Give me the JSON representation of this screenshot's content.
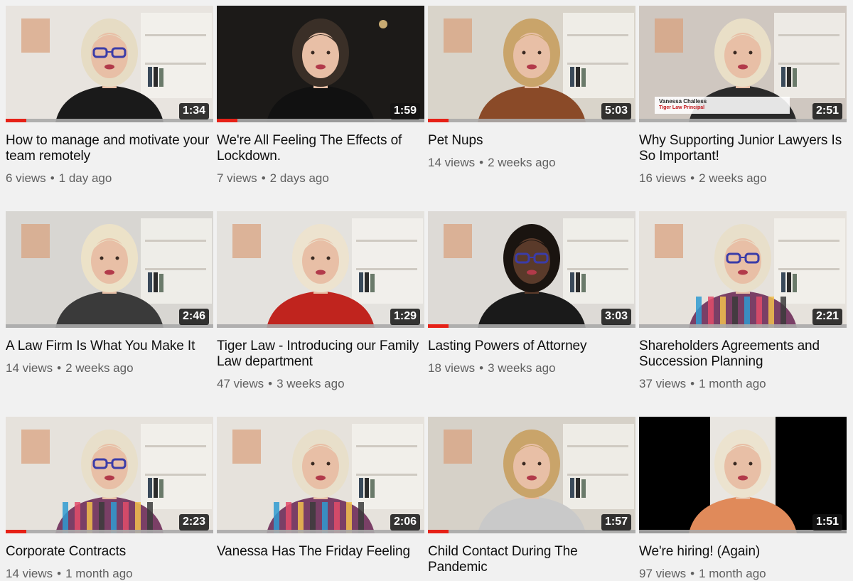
{
  "videos": [
    {
      "title": "How to manage and motivate your team remotely",
      "views": "6 views",
      "age": "1 day ago",
      "duration": "1:34",
      "watched_fraction": 0.1,
      "bg": "#e8e4df",
      "hair": "#e6dcc4",
      "top": "#1a1a1a",
      "glasses": true
    },
    {
      "title": "We're All Feeling The Effects of Lockdown.",
      "views": "7 views",
      "age": "2 days ago",
      "duration": "1:59",
      "watched_fraction": 0.1,
      "bg": "#1c1a18",
      "hair": "#3a2f27",
      "top": "#111111",
      "glasses": false
    },
    {
      "title": "Pet Nups",
      "views": "14 views",
      "age": "2 weeks ago",
      "duration": "5:03",
      "watched_fraction": 0.1,
      "bg": "#d9d4ca",
      "hair": "#c9a46a",
      "top": "#8a4a28",
      "glasses": false
    },
    {
      "title": "Why Supporting Junior Lawyers Is So Important!",
      "views": "16 views",
      "age": "2 weeks ago",
      "duration": "2:51",
      "watched_fraction": 0,
      "bg": "#cfc7c0",
      "hair": "#e9dfc7",
      "top": "#2a2a2a",
      "glasses": false,
      "lower_third": {
        "name": "Vanessa Challess",
        "role": "Tiger Law Principal"
      }
    },
    {
      "title": "A Law Firm Is What You Make It",
      "views": "14 views",
      "age": "2 weeks ago",
      "duration": "2:46",
      "watched_fraction": 0,
      "bg": "#d8d6d2",
      "hair": "#ece2c8",
      "top": "#3a3a3a",
      "glasses": false
    },
    {
      "title": "Tiger Law - Introducing our Family Law department",
      "views": "47 views",
      "age": "3 weeks ago",
      "duration": "1:29",
      "watched_fraction": 0,
      "bg": "#e4e2de",
      "hair": "#ede3cf",
      "top": "#c0241e",
      "glasses": false
    },
    {
      "title": "Lasting Powers of Attorney",
      "views": "18 views",
      "age": "3 weeks ago",
      "duration": "3:03",
      "watched_fraction": 0.1,
      "bg": "#dddad6",
      "hair": "#1a1410",
      "top": "#1a1a1a",
      "glasses": true,
      "skin": "#5a3a2a"
    },
    {
      "title": "Shareholders Agreements and Succession Planning",
      "views": "37 views",
      "age": "1 month ago",
      "duration": "2:21",
      "watched_fraction": 0,
      "bg": "#e6e2dc",
      "hair": "#e8dfca",
      "top": "#7a3f66",
      "glasses": true,
      "stripes": true
    },
    {
      "title": "Corporate Contracts",
      "views": "14 views",
      "age": "1 month ago",
      "duration": "2:23",
      "watched_fraction": 0.1,
      "bg": "#e6e2dc",
      "hair": "#e8dfca",
      "top": "#7a3f66",
      "glasses": true,
      "stripes": true
    },
    {
      "title": "Vanessa Has The Friday Feeling",
      "views": "",
      "age": "",
      "duration": "2:06",
      "watched_fraction": 0,
      "bg": "#e6e2dc",
      "hair": "#e8dfca",
      "top": "#7a3f66",
      "glasses": false,
      "stripes": true
    },
    {
      "title": "Child Contact During The Pandemic",
      "views": "",
      "age": "",
      "duration": "1:57",
      "watched_fraction": 0.1,
      "bg": "#d6d1c8",
      "hair": "#c9a46a",
      "top": "#c9c9c9",
      "glasses": false
    },
    {
      "title": "We're hiring! (Again)",
      "views": "97 views",
      "age": "1 month ago",
      "duration": "1:51",
      "watched_fraction": 0,
      "bg": "#000000",
      "hair": "#ece3cf",
      "top": "#e08a5a",
      "glasses": false,
      "pillarbox": true
    }
  ],
  "colors": {
    "progress": "#e62117",
    "meta_text": "#606060",
    "title_text": "#0f0f0f",
    "background": "#f1f1f1"
  }
}
